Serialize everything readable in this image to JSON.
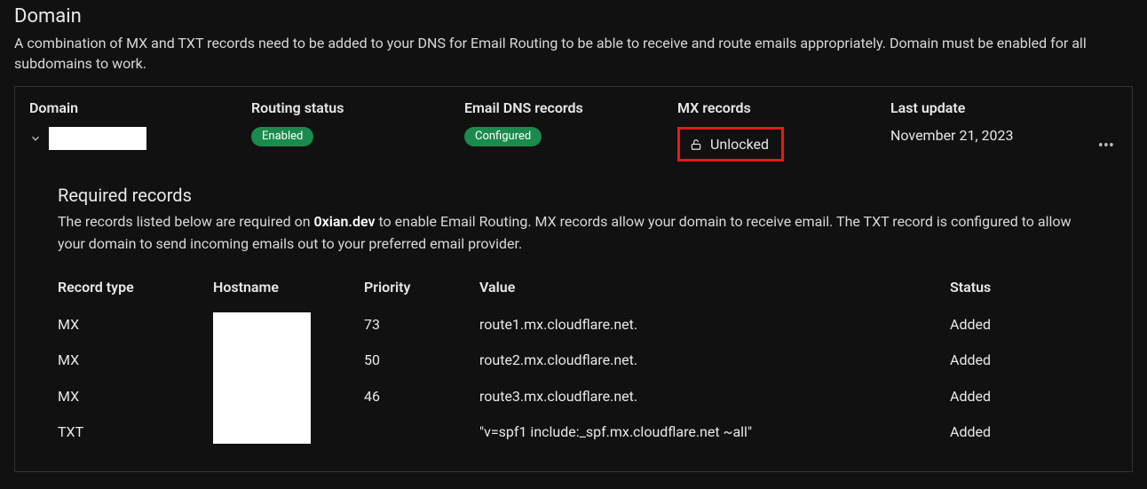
{
  "title": "Domain",
  "description": "A combination of MX and TXT records need to be added to your DNS for Email Routing to be able to receive and route emails appropriately. Domain must be enabled for all subdomains to work.",
  "summary": {
    "domain_label": "Domain",
    "routing_label": "Routing status",
    "routing_value": "Enabled",
    "dns_label": "Email DNS records",
    "dns_value": "Configured",
    "mx_label": "MX records",
    "mx_value": "Unlocked",
    "last_update_label": "Last update",
    "last_update_value": "November 21, 2023"
  },
  "required": {
    "title": "Required records",
    "desc_prefix": "The records listed below are required on ",
    "domain": "0xian.dev",
    "desc_suffix": " to enable Email Routing. MX records allow your domain to receive email. The TXT record is configured to allow your domain to send incoming emails out to your preferred email provider.",
    "headers": {
      "type": "Record type",
      "hostname": "Hostname",
      "priority": "Priority",
      "value": "Value",
      "status": "Status"
    },
    "rows": [
      {
        "type": "MX",
        "priority": "73",
        "value": "route1.mx.cloudflare.net.",
        "status": "Added"
      },
      {
        "type": "MX",
        "priority": "50",
        "value": "route2.mx.cloudflare.net.",
        "status": "Added"
      },
      {
        "type": "MX",
        "priority": "46",
        "value": "route3.mx.cloudflare.net.",
        "status": "Added"
      },
      {
        "type": "TXT",
        "priority": "",
        "value": "\"v=spf1 include:_spf.mx.cloudflare.net ~all\"",
        "status": "Added"
      }
    ]
  }
}
